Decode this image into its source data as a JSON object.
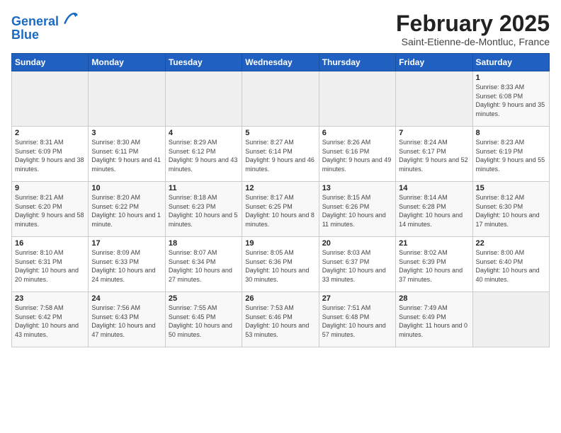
{
  "header": {
    "logo_line1": "General",
    "logo_line2": "Blue",
    "month_title": "February 2025",
    "location": "Saint-Etienne-de-Montluc, France"
  },
  "weekdays": [
    "Sunday",
    "Monday",
    "Tuesday",
    "Wednesday",
    "Thursday",
    "Friday",
    "Saturday"
  ],
  "weeks": [
    [
      {
        "day": "",
        "info": ""
      },
      {
        "day": "",
        "info": ""
      },
      {
        "day": "",
        "info": ""
      },
      {
        "day": "",
        "info": ""
      },
      {
        "day": "",
        "info": ""
      },
      {
        "day": "",
        "info": ""
      },
      {
        "day": "1",
        "info": "Sunrise: 8:33 AM\nSunset: 6:08 PM\nDaylight: 9 hours and 35 minutes."
      }
    ],
    [
      {
        "day": "2",
        "info": "Sunrise: 8:31 AM\nSunset: 6:09 PM\nDaylight: 9 hours and 38 minutes."
      },
      {
        "day": "3",
        "info": "Sunrise: 8:30 AM\nSunset: 6:11 PM\nDaylight: 9 hours and 41 minutes."
      },
      {
        "day": "4",
        "info": "Sunrise: 8:29 AM\nSunset: 6:12 PM\nDaylight: 9 hours and 43 minutes."
      },
      {
        "day": "5",
        "info": "Sunrise: 8:27 AM\nSunset: 6:14 PM\nDaylight: 9 hours and 46 minutes."
      },
      {
        "day": "6",
        "info": "Sunrise: 8:26 AM\nSunset: 6:16 PM\nDaylight: 9 hours and 49 minutes."
      },
      {
        "day": "7",
        "info": "Sunrise: 8:24 AM\nSunset: 6:17 PM\nDaylight: 9 hours and 52 minutes."
      },
      {
        "day": "8",
        "info": "Sunrise: 8:23 AM\nSunset: 6:19 PM\nDaylight: 9 hours and 55 minutes."
      }
    ],
    [
      {
        "day": "9",
        "info": "Sunrise: 8:21 AM\nSunset: 6:20 PM\nDaylight: 9 hours and 58 minutes."
      },
      {
        "day": "10",
        "info": "Sunrise: 8:20 AM\nSunset: 6:22 PM\nDaylight: 10 hours and 1 minute."
      },
      {
        "day": "11",
        "info": "Sunrise: 8:18 AM\nSunset: 6:23 PM\nDaylight: 10 hours and 5 minutes."
      },
      {
        "day": "12",
        "info": "Sunrise: 8:17 AM\nSunset: 6:25 PM\nDaylight: 10 hours and 8 minutes."
      },
      {
        "day": "13",
        "info": "Sunrise: 8:15 AM\nSunset: 6:26 PM\nDaylight: 10 hours and 11 minutes."
      },
      {
        "day": "14",
        "info": "Sunrise: 8:14 AM\nSunset: 6:28 PM\nDaylight: 10 hours and 14 minutes."
      },
      {
        "day": "15",
        "info": "Sunrise: 8:12 AM\nSunset: 6:30 PM\nDaylight: 10 hours and 17 minutes."
      }
    ],
    [
      {
        "day": "16",
        "info": "Sunrise: 8:10 AM\nSunset: 6:31 PM\nDaylight: 10 hours and 20 minutes."
      },
      {
        "day": "17",
        "info": "Sunrise: 8:09 AM\nSunset: 6:33 PM\nDaylight: 10 hours and 24 minutes."
      },
      {
        "day": "18",
        "info": "Sunrise: 8:07 AM\nSunset: 6:34 PM\nDaylight: 10 hours and 27 minutes."
      },
      {
        "day": "19",
        "info": "Sunrise: 8:05 AM\nSunset: 6:36 PM\nDaylight: 10 hours and 30 minutes."
      },
      {
        "day": "20",
        "info": "Sunrise: 8:03 AM\nSunset: 6:37 PM\nDaylight: 10 hours and 33 minutes."
      },
      {
        "day": "21",
        "info": "Sunrise: 8:02 AM\nSunset: 6:39 PM\nDaylight: 10 hours and 37 minutes."
      },
      {
        "day": "22",
        "info": "Sunrise: 8:00 AM\nSunset: 6:40 PM\nDaylight: 10 hours and 40 minutes."
      }
    ],
    [
      {
        "day": "23",
        "info": "Sunrise: 7:58 AM\nSunset: 6:42 PM\nDaylight: 10 hours and 43 minutes."
      },
      {
        "day": "24",
        "info": "Sunrise: 7:56 AM\nSunset: 6:43 PM\nDaylight: 10 hours and 47 minutes."
      },
      {
        "day": "25",
        "info": "Sunrise: 7:55 AM\nSunset: 6:45 PM\nDaylight: 10 hours and 50 minutes."
      },
      {
        "day": "26",
        "info": "Sunrise: 7:53 AM\nSunset: 6:46 PM\nDaylight: 10 hours and 53 minutes."
      },
      {
        "day": "27",
        "info": "Sunrise: 7:51 AM\nSunset: 6:48 PM\nDaylight: 10 hours and 57 minutes."
      },
      {
        "day": "28",
        "info": "Sunrise: 7:49 AM\nSunset: 6:49 PM\nDaylight: 11 hours and 0 minutes."
      },
      {
        "day": "",
        "info": ""
      }
    ]
  ]
}
